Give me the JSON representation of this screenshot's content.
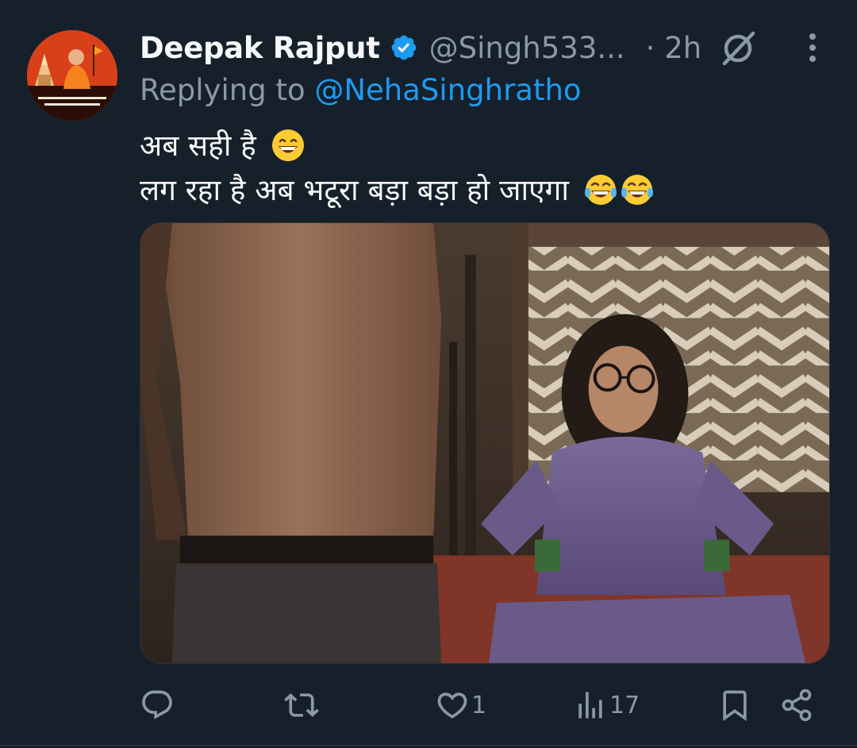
{
  "tweet": {
    "author": {
      "display_name": "Deepak Rajput",
      "handle": "@Singh533...",
      "verified": true
    },
    "time": "· 2h",
    "reply_prefix": "Replying to ",
    "reply_mention": "@NehaSinghratho",
    "text_line1": "अब सही है",
    "text_line2": "लग रहा है अब भटूरा बड़ा बड़ा हो जाएगा",
    "emoji_line1": "grinning-face-emoji",
    "emoji_line2": [
      "tears-of-joy-emoji",
      "tears-of-joy-emoji"
    ]
  },
  "actions": {
    "reply_count": "",
    "retweet_count": "",
    "like_count": "1",
    "views_count": "17"
  },
  "icons": {
    "verified": "verified-badge-icon",
    "grok": "grok-icon",
    "more": "more-vertical-icon",
    "reply": "reply-icon",
    "retweet": "retweet-icon",
    "like": "heart-icon",
    "views": "views-icon",
    "bookmark": "bookmark-icon",
    "share": "share-icon"
  },
  "colors": {
    "background": "#15202b",
    "primary_text": "#f7f9f9",
    "secondary_text": "#8b98a5",
    "accent": "#1d9bf0"
  }
}
